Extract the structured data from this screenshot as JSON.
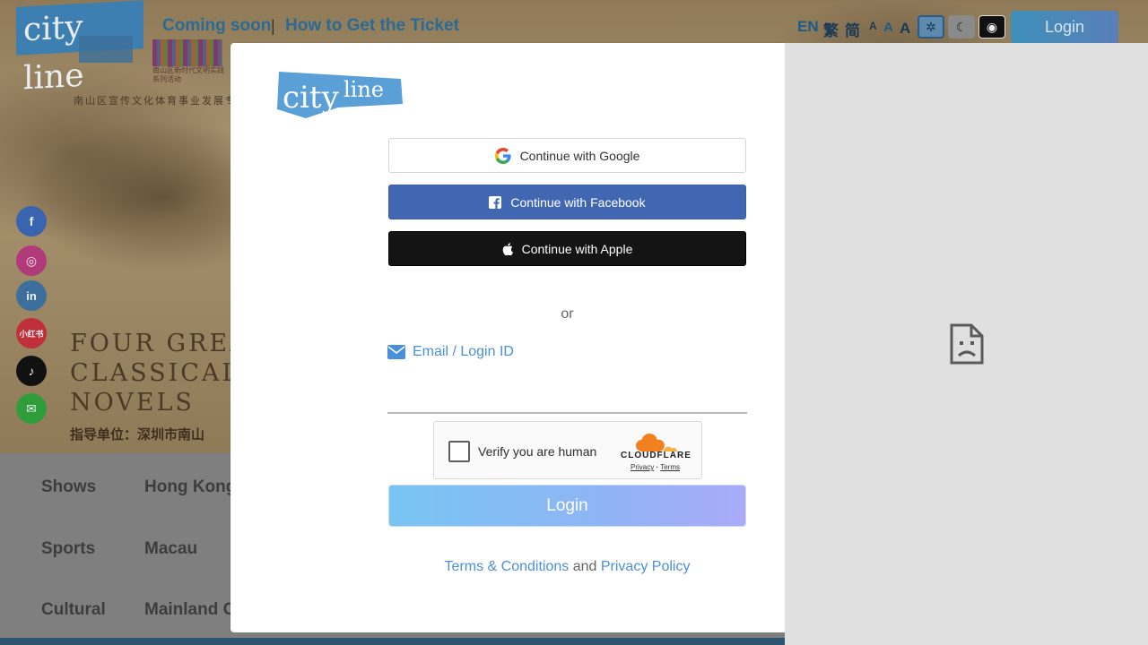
{
  "background": {
    "brand": "city line",
    "top_links": [
      "Coming soon",
      "How to Get the Ticket"
    ],
    "separator": "|",
    "languages": [
      "EN",
      "繁",
      "简"
    ],
    "font_sizes": [
      "A",
      "A",
      "A"
    ],
    "login_label": "Login",
    "sponsor_caption": "南山区新时代文明实践系列活动",
    "subcaption": "南山区宣传文化体育事业发展专",
    "title_lines": [
      "FOUR GREA",
      "CLASSICAL",
      "NOVELS"
    ],
    "guide_text": "指导单位：深圳市南山",
    "nav_categories": [
      "Shows",
      "Sports",
      "Cultural"
    ],
    "nav_regions": [
      "Hong Kong",
      "Macau",
      "Mainland C"
    ],
    "social_icons": [
      {
        "name": "facebook-icon",
        "glyph": "f",
        "color": "#3a64b0"
      },
      {
        "name": "instagram-icon",
        "glyph": "◎",
        "color": "#b03a7a"
      },
      {
        "name": "linkedin-icon",
        "glyph": "in",
        "color": "#3c6f9b"
      },
      {
        "name": "xiaohongshu-icon",
        "glyph": "小红书",
        "color": "#c0303a"
      },
      {
        "name": "tiktok-icon",
        "glyph": "♪",
        "color": "#111111"
      },
      {
        "name": "wechat-icon",
        "glyph": "✉",
        "color": "#2f9e3a"
      }
    ]
  },
  "modal": {
    "logo_text": "cityline",
    "google_label": "Continue with Google",
    "facebook_label": "Continue with Facebook",
    "apple_label": "Continue with Apple",
    "or_text": "or",
    "email_label": "Email / Login ID",
    "email_value": "",
    "captcha_label": "Verify you are human",
    "captcha_brand": "CLOUDFLARE",
    "captcha_privacy": "Privacy",
    "captcha_sep": "·",
    "captcha_terms": "Terms",
    "login_label": "Login",
    "terms_label": "Terms & Conditions",
    "and_text": "and",
    "privacy_label": "Privacy Policy"
  },
  "side_panel": {
    "icon": "broken-document-icon"
  },
  "colors": {
    "facebook": "#4267b2",
    "apple": "#141414",
    "link": "#4a8fd9",
    "login_gradient_start": "#78c5f2",
    "login_gradient_end": "#aaaaf8",
    "logo_blue": "#5a9fd6"
  }
}
